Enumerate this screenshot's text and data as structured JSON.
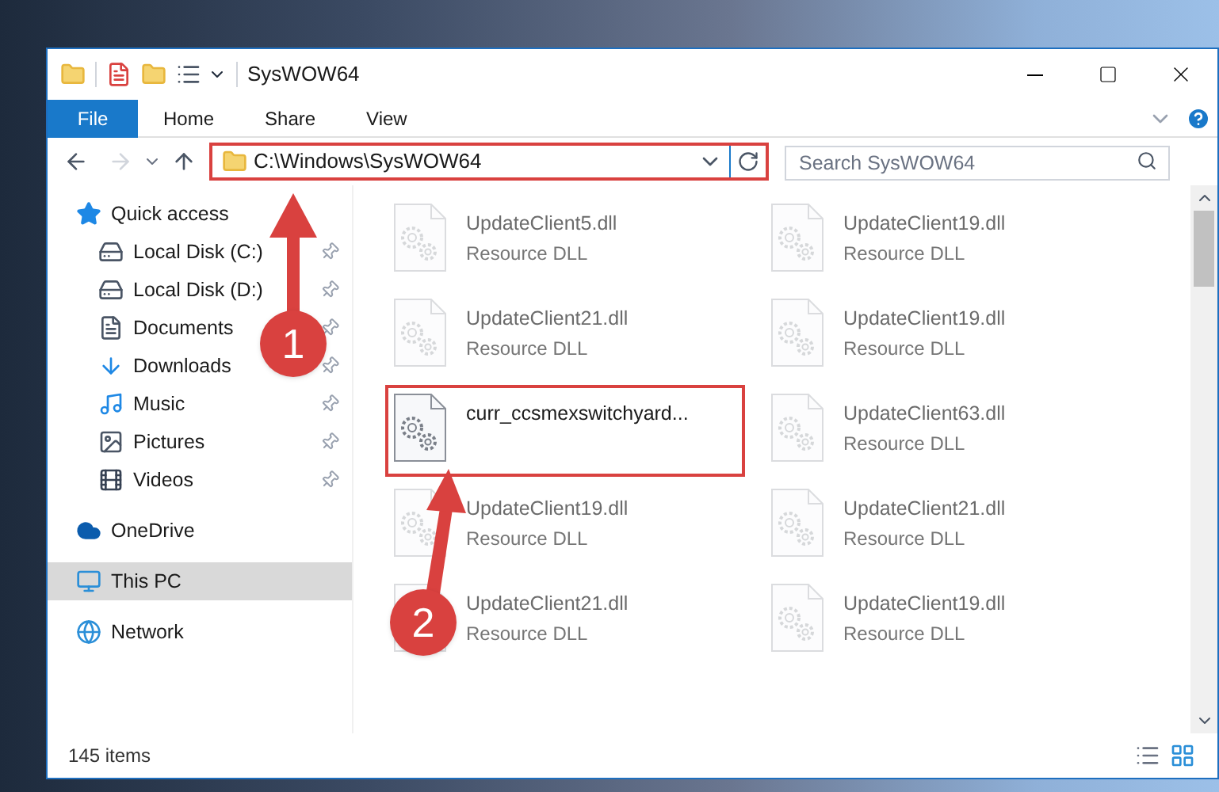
{
  "window": {
    "title": "SysWOW64"
  },
  "ribbon": {
    "tabs": [
      {
        "label": "File",
        "selected": true
      },
      {
        "label": "Home",
        "selected": false
      },
      {
        "label": "Share",
        "selected": false
      },
      {
        "label": "View",
        "selected": false
      }
    ]
  },
  "address": {
    "path": "C:\\Windows\\SysWOW64",
    "annotated": true
  },
  "search": {
    "placeholder": "Search SysWOW64"
  },
  "nav_pane": [
    {
      "label": "Quick access",
      "kind": "star",
      "selected": false,
      "children": [
        {
          "label": "Local Disk (C:)",
          "kind": "system-drive",
          "pinned": true
        },
        {
          "label": "Local Disk (D:)",
          "kind": "drive",
          "pinned": true
        },
        {
          "label": "Documents",
          "kind": "documents",
          "pinned": true
        },
        {
          "label": "Downloads",
          "kind": "downloads",
          "pinned": true
        },
        {
          "label": "Music",
          "kind": "music",
          "pinned": true
        },
        {
          "label": "Pictures",
          "kind": "pictures",
          "pinned": true
        },
        {
          "label": "Videos",
          "kind": "videos",
          "pinned": true
        }
      ]
    },
    {
      "label": "OneDrive",
      "kind": "cloud",
      "selected": false
    },
    {
      "label": "This PC",
      "kind": "computer",
      "selected": true
    },
    {
      "label": "Network",
      "kind": "network",
      "selected": false
    }
  ],
  "files": [
    {
      "name": "UpdateClient5.dll",
      "type": "Resource DLL",
      "blurred": true,
      "annotated": false
    },
    {
      "name": "UpdateClient19.dll",
      "type": "Resource DLL",
      "blurred": true,
      "annotated": false
    },
    {
      "name": "UpdateClient21.dll",
      "type": "Resource DLL",
      "blurred": true,
      "annotated": false
    },
    {
      "name": "UpdateClient19.dll",
      "type": "Resource DLL",
      "blurred": true,
      "annotated": false
    },
    {
      "name": "curr_ccsmexswitchyard...",
      "blurred": false,
      "annotated": true
    },
    {
      "name": "UpdateClient63.dll",
      "type": "Resource DLL",
      "blurred": true,
      "annotated": false
    },
    {
      "name": "UpdateClient19.dll",
      "type": "Resource DLL",
      "blurred": true,
      "annotated": false
    },
    {
      "name": "UpdateClient21.dll",
      "type": "Resource DLL",
      "blurred": true,
      "annotated": false
    },
    {
      "name": "UpdateClient21.dll",
      "type": "Resource DLL",
      "blurred": true,
      "annotated": false
    },
    {
      "name": "UpdateClient19.dll",
      "type": "Resource DLL",
      "blurred": true,
      "annotated": false
    }
  ],
  "status_bar": {
    "item_count": "145 items"
  },
  "annotations": [
    {
      "number": "1"
    },
    {
      "number": "2"
    }
  ]
}
